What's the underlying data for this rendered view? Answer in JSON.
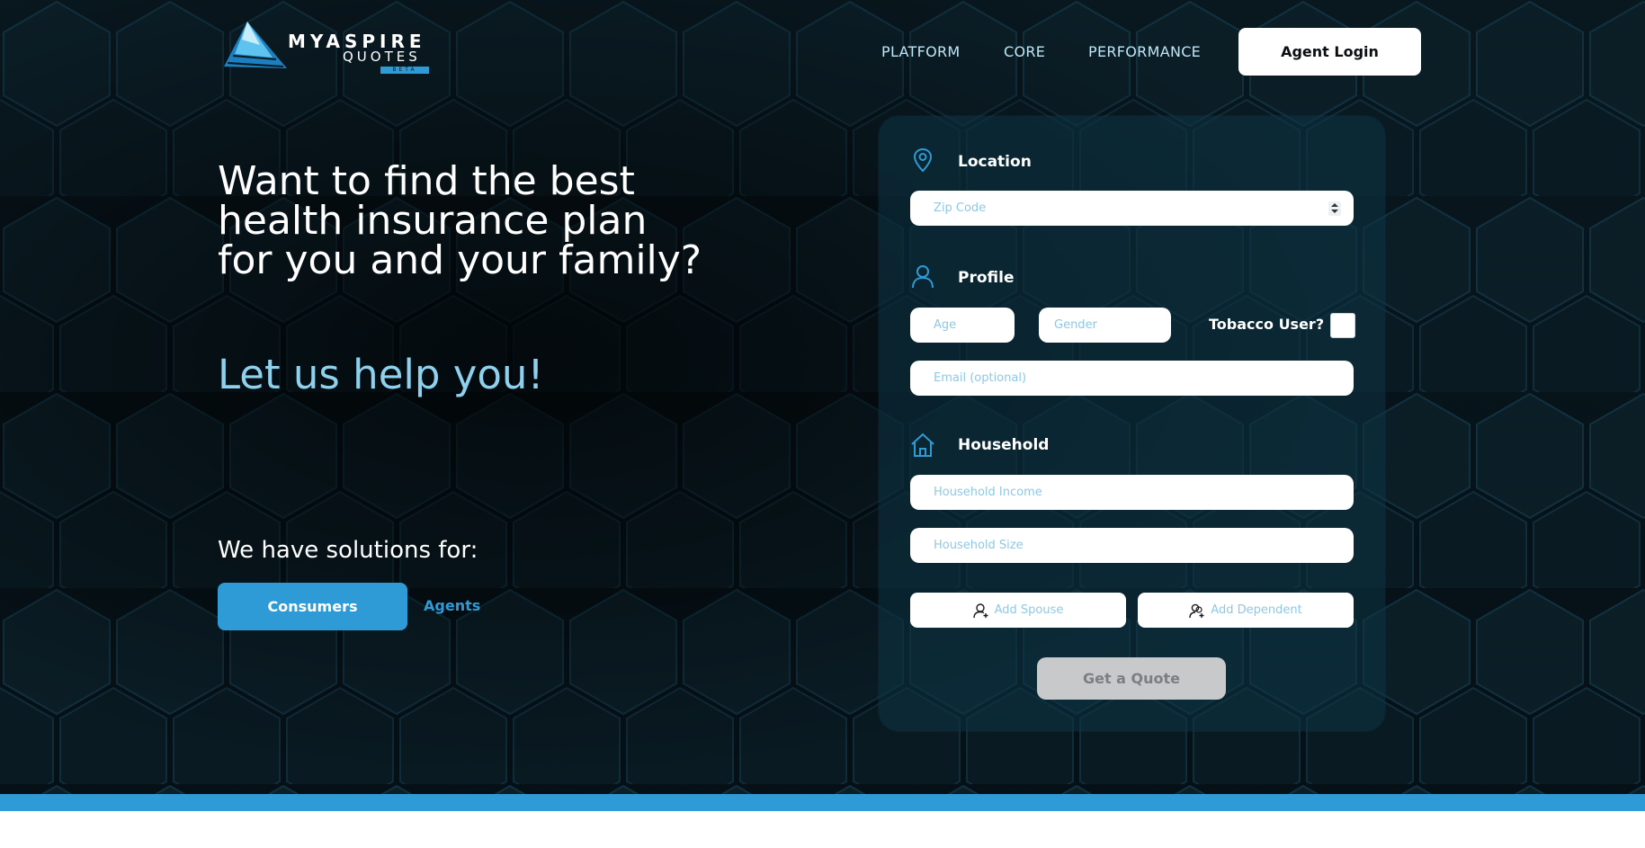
{
  "brand": {
    "name_top": "MYASPIRE",
    "name_bottom": "QUOTES",
    "tag": "BETA"
  },
  "nav": {
    "links": [
      "PLATFORM",
      "CORE",
      "PERFORMANCE"
    ],
    "login_label": "Agent Login"
  },
  "hero": {
    "headline_lines": [
      "Want to find the best",
      "health insurance plan",
      "for you and your family?"
    ],
    "subhead": "Let us help you!",
    "solutions_label": "We have solutions for:",
    "consumers_label": "Consumers",
    "agents_label": "Agents"
  },
  "form": {
    "location": {
      "label": "Location",
      "zip_placeholder": "Zip Code"
    },
    "profile": {
      "label": "Profile",
      "age_placeholder": "Age",
      "gender_placeholder": "Gender",
      "tobacco_label": "Tobacco User?",
      "email_placeholder": "Email (optional)"
    },
    "household": {
      "label": "Household",
      "income_placeholder": "Household Income",
      "size_placeholder": "Household Size"
    },
    "add_spouse_label": "Add Spouse",
    "add_dependent_label": "Add Dependent",
    "submit_label": "Get a Quote"
  },
  "colors": {
    "accent": "#2e9bd6",
    "subhead": "#8ed1ef",
    "background": "#0a1a22"
  },
  "icons": {
    "location": "map-pin-icon",
    "profile": "user-icon",
    "household": "home-icon",
    "spouse": "add-user-icon",
    "dependent": "add-dependent-icon"
  }
}
